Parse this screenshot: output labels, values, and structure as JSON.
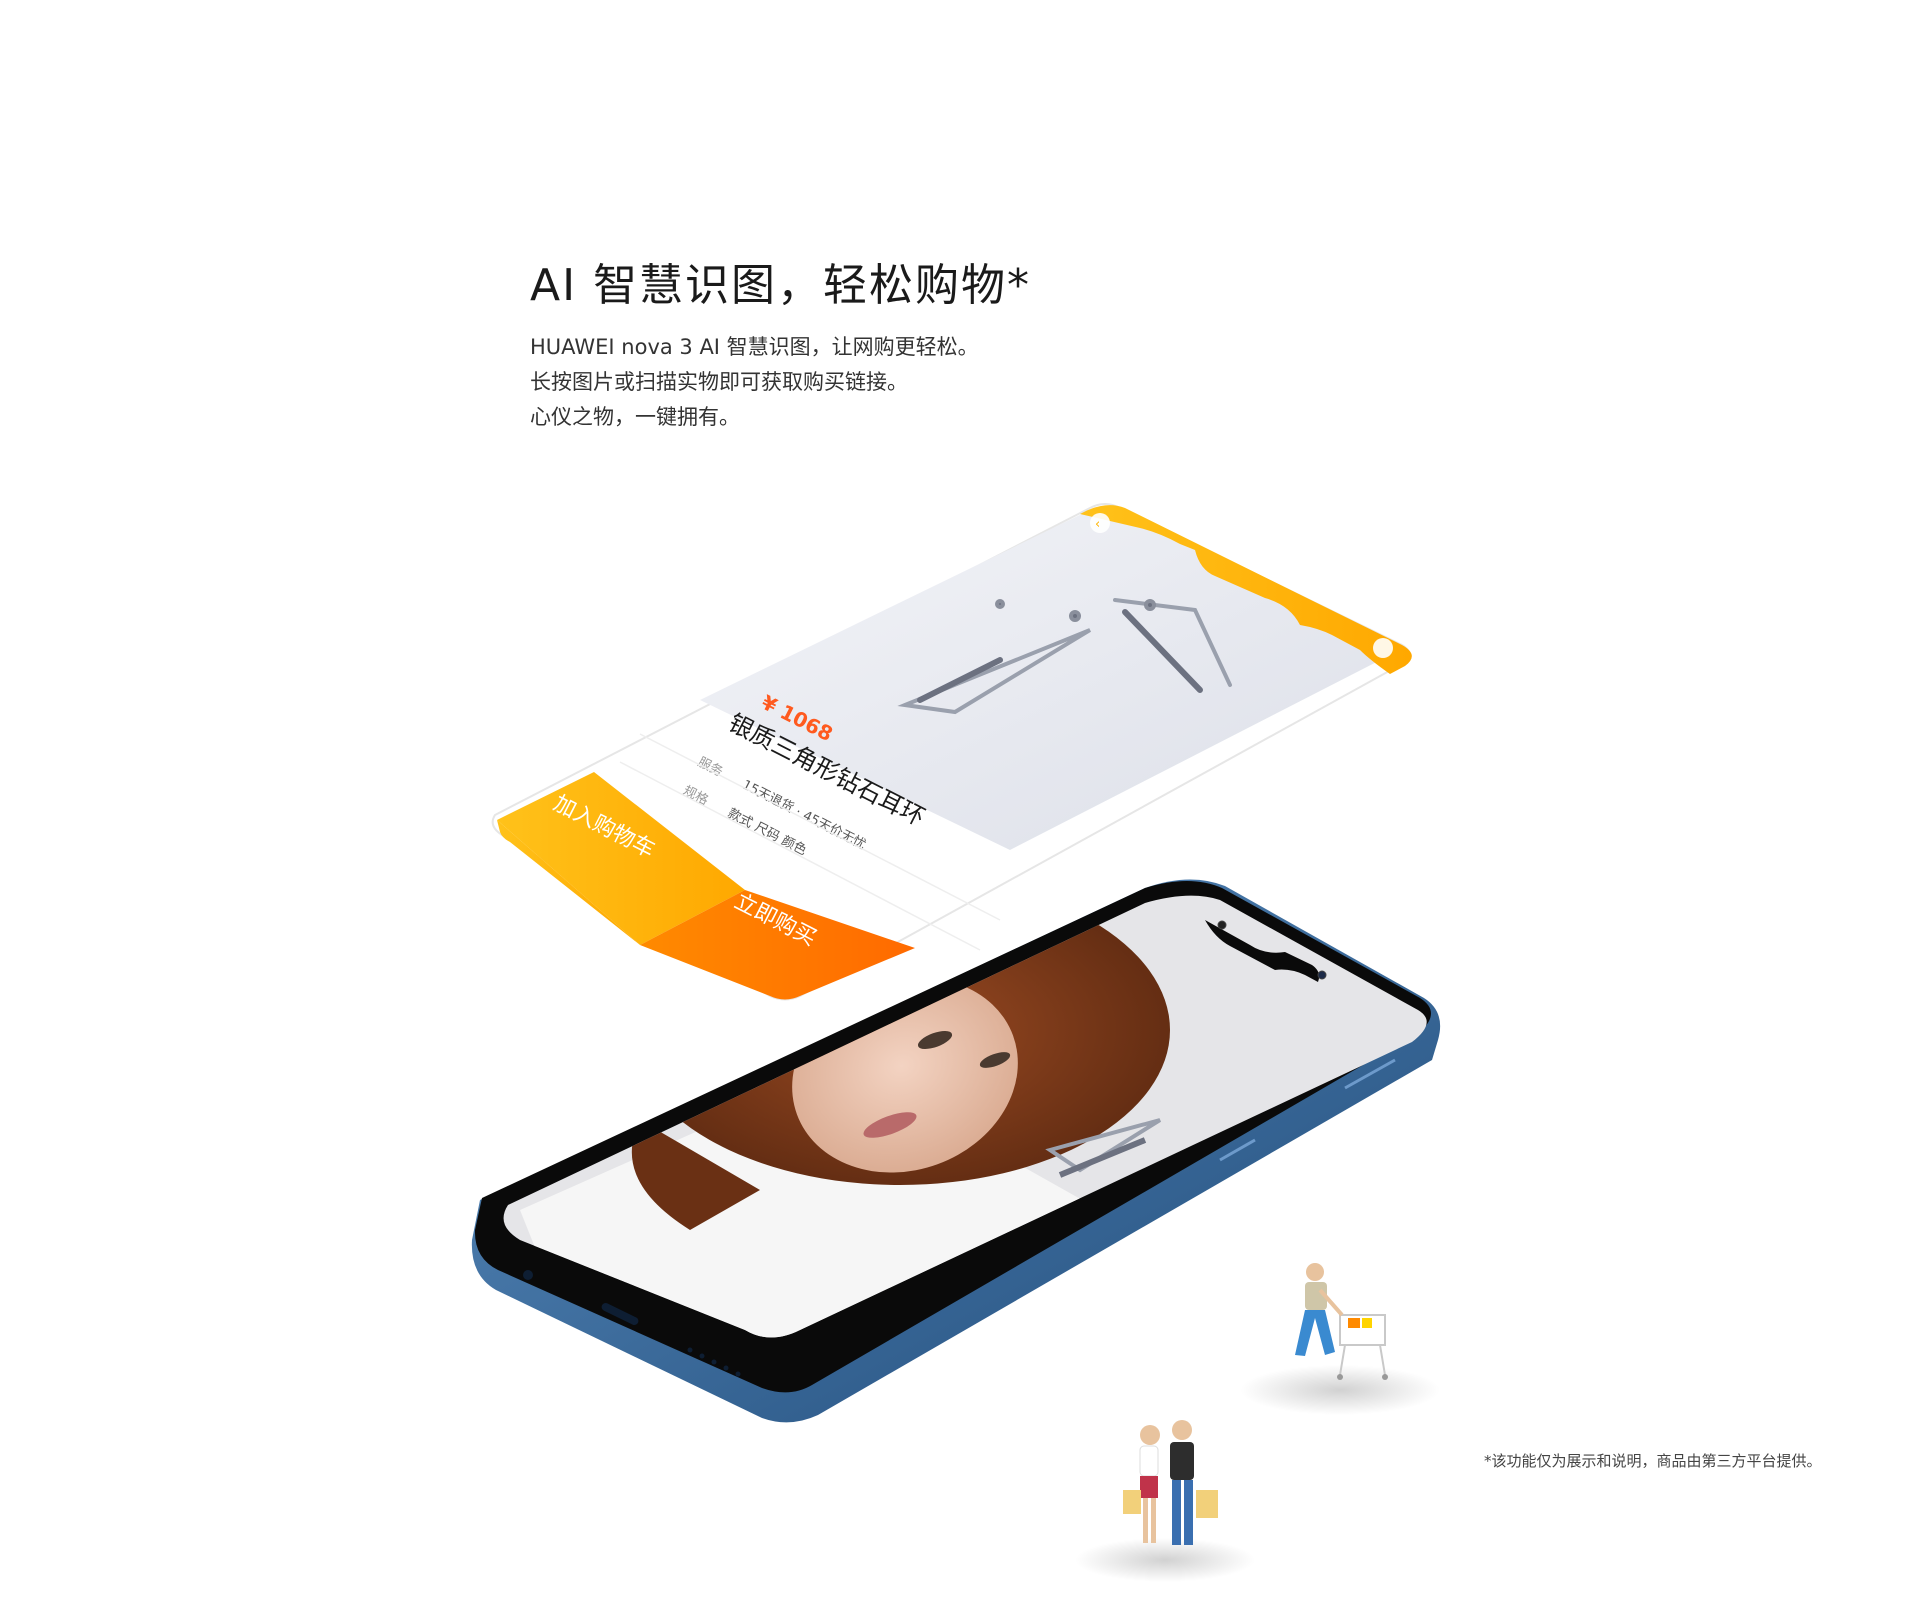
{
  "headline": "AI 智慧识图，轻松购物*",
  "description": {
    "line1": "HUAWEI nova 3 AI 智慧识图，让网购更轻松。",
    "line2": "长按图片或扫描实物即可获取购买链接。",
    "line3": "心仪之物，一键拥有。"
  },
  "footnote": "*该功能仅为展示和说明，商品由第三方平台提供。",
  "shopping_screen": {
    "price": "¥ 1068",
    "product_name": "银质三角形钻石耳环",
    "shipping_label": "服务",
    "shipping_value": "15天退货 · 45天价无忧",
    "spec_label": "规格",
    "spec_value": "款式 尺码 颜色",
    "add_to_cart": "加入购物车",
    "buy_now": "立即购买"
  },
  "colors": {
    "accent_yellow": "#FFB400",
    "accent_orange": "#FF7A00",
    "phone_body": "#2f5f8f",
    "price_red": "#ff5a1f"
  }
}
